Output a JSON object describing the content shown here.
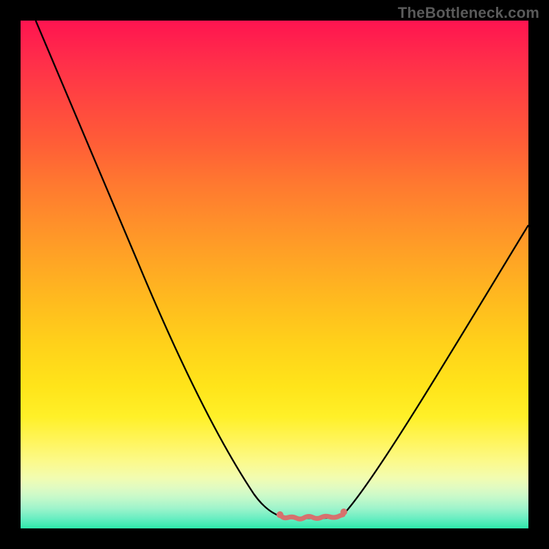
{
  "watermark": "TheBottleneck.com",
  "colors": {
    "background": "#000000",
    "curve": "#000000",
    "valley_marker": "#d6726e",
    "gradient_top": "#ff1450",
    "gradient_bottom": "#2de8ab"
  },
  "chart_data": {
    "type": "line",
    "title": "",
    "xlabel": "",
    "ylabel": "",
    "xlim": [
      0,
      100
    ],
    "ylim": [
      0,
      100
    ],
    "grid": false,
    "legend": false,
    "series": [
      {
        "name": "left_branch",
        "x": [
          3,
          7,
          12,
          17,
          22,
          27,
          32,
          37,
          42,
          46,
          49,
          51,
          53
        ],
        "y": [
          100,
          90,
          78,
          66,
          54,
          42,
          30,
          20,
          12,
          6,
          3,
          2,
          2
        ]
      },
      {
        "name": "valley",
        "x": [
          53,
          55,
          57,
          59,
          61,
          63
        ],
        "y": [
          2,
          2,
          2,
          2,
          2,
          2
        ]
      },
      {
        "name": "right_branch",
        "x": [
          63,
          66,
          70,
          75,
          80,
          85,
          90,
          95,
          100
        ],
        "y": [
          2,
          4,
          8,
          15,
          23,
          32,
          42,
          52,
          60
        ]
      }
    ],
    "annotations": [
      {
        "text": "TheBottleneck.com",
        "position": "top-right"
      }
    ]
  }
}
